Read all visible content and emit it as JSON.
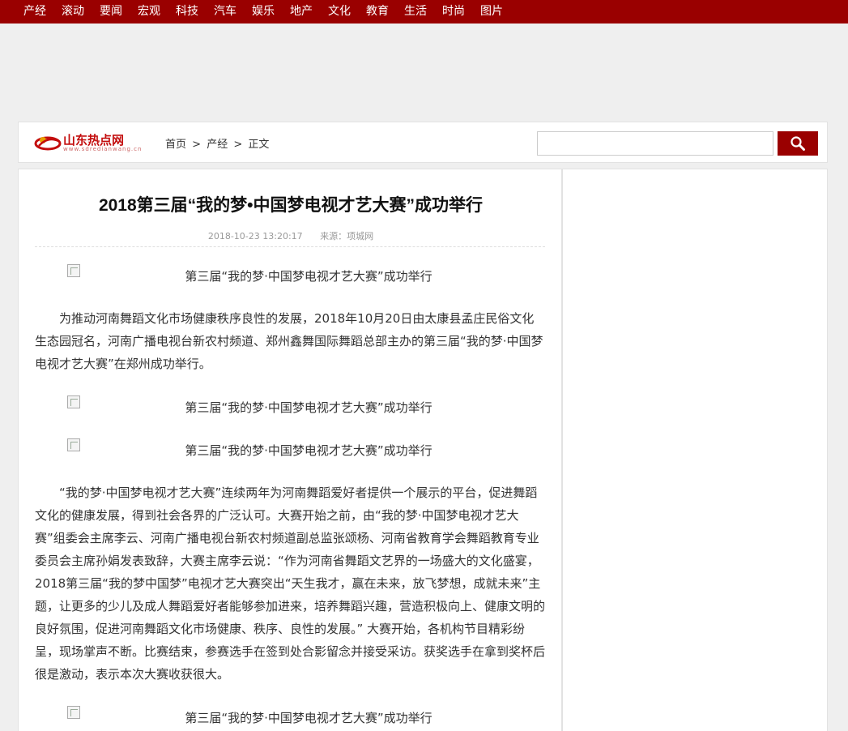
{
  "nav": {
    "items": [
      "产经",
      "滚动",
      "要闻",
      "宏观",
      "科技",
      "汽车",
      "娱乐",
      "地产",
      "文化",
      "教育",
      "生活",
      "时尚",
      "图片"
    ]
  },
  "header": {
    "logo_text": "山东热点网",
    "logo_sub": "www.sdredianwang.cn",
    "breadcrumb": [
      "首页",
      ">",
      "产经",
      ">",
      "正文"
    ],
    "search_placeholder": ""
  },
  "article": {
    "title": "2018第三届“我的梦•中国梦电视才艺大赛”成功举行",
    "date": "2018-10-23 13:20:17",
    "source": "来源：项城网",
    "image_caption": "第三届“我的梦·中国梦电视才艺大赛”成功举行",
    "paragraph1": "为推动河南舞蹈文化市场健康秩序良性的发展，2018年10月20日由太康县孟庄民俗文化生态园冠名，河南广播电视台新农村频道、郑州鑫舞国际舞蹈总部主办的第三届“我的梦·中国梦电视才艺大赛”在郑州成功举行。",
    "paragraph2": "“我的梦·中国梦电视才艺大赛”连续两年为河南舞蹈爱好者提供一个展示的平台，促进舞蹈文化的健康发展，得到社会各界的广泛认可。大赛开始之前，由“我的梦·中国梦电视才艺大赛”组委会主席李云、河南广播电视台新农村频道副总监张颂杨、河南省教育学会舞蹈教育专业委员会主席孙娟发表致辞，大赛主席李云说：“作为河南省舞蹈文艺界的一场盛大的文化盛宴，2018第三届“我的梦中国梦”电视才艺大赛突出“天生我才，赢在未来，放飞梦想，成就未来”主题，让更多的少儿及成人舞蹈爱好者能够参加进来，培养舞蹈兴趣，营造积极向上、健康文明的良好氛围，促进河南舞蹈文化市场健康、秩序、良性的发展。” 大赛开始，各机构节目精彩纷呈，现场掌声不断。比赛结束，参赛选手在签到处合影留念并接受采访。获奖选手在拿到奖杯后很是激动，表示本次大赛收获很大。"
  },
  "colors": {
    "brand_red": "#9a0000",
    "logo_red": "#c30d0d"
  },
  "icons": {
    "search": "search-icon",
    "broken_image": "broken-image-icon"
  }
}
